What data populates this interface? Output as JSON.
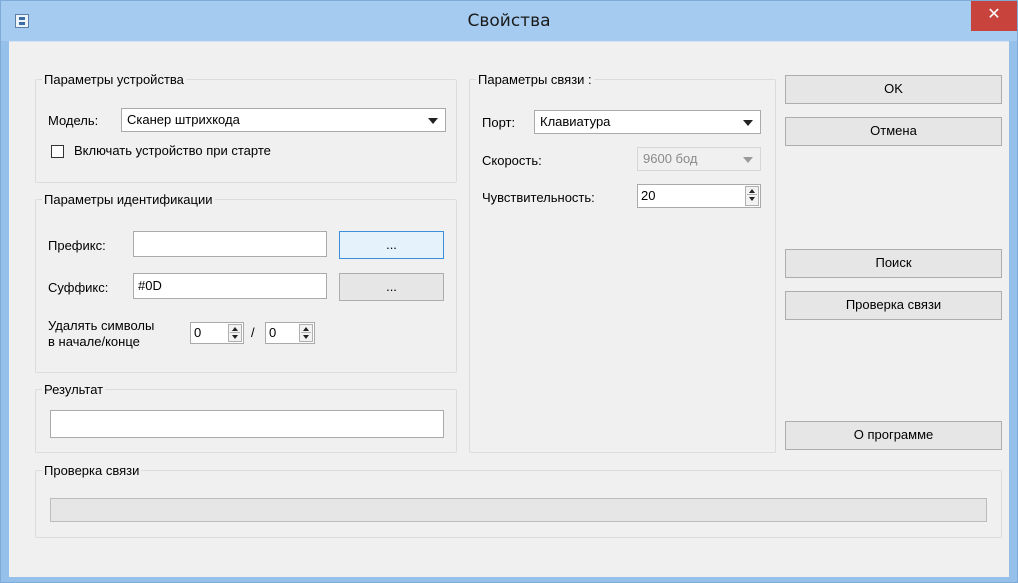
{
  "window": {
    "title": "Свойства",
    "close_glyph": "✕"
  },
  "device_group": {
    "label": "Параметры устройства",
    "model_label": "Модель:",
    "model_value": "Сканер штрихкода",
    "start_checkbox_label": "Включать устройство при старте",
    "start_checked": false
  },
  "ident_group": {
    "label": "Параметры идентификации",
    "prefix_label": "Префикс:",
    "prefix_value": "",
    "prefix_btn": "...",
    "suffix_label": "Суффикс:",
    "suffix_value": "#0D",
    "suffix_btn": "...",
    "strip_label_1": "Удалять символы",
    "strip_label_2": "в начале/конце",
    "strip_start": "0",
    "strip_sep": "/",
    "strip_end": "0"
  },
  "result_group": {
    "label": "Результат",
    "value": ""
  },
  "conn_group": {
    "label": "Параметры связи :",
    "port_label": "Порт:",
    "port_value": "Клавиатура",
    "speed_label": "Скорость:",
    "speed_value": "9600 бод",
    "sens_label": "Чувствительность:",
    "sens_value": "20"
  },
  "buttons": {
    "ok": "OK",
    "cancel": "Отмена",
    "search": "Поиск",
    "check": "Проверка связи",
    "about": "О программе"
  },
  "check_group": {
    "label": "Проверка связи",
    "progress": 0
  },
  "colors": {
    "title_bar": "#a6cbf0",
    "close": "#c7433c",
    "focus": "#3d8fdc"
  },
  "icons": {
    "app": "app-icon",
    "close": "close-icon",
    "dropdown": "chevron-down-icon"
  }
}
